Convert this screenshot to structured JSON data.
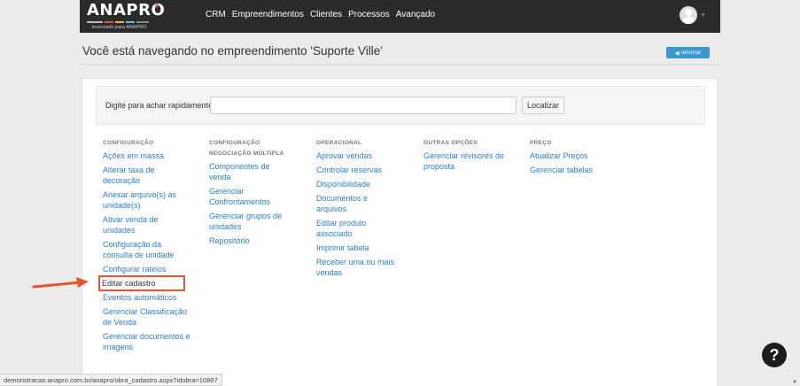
{
  "brand": {
    "name": "ANAPRO",
    "plus": "+",
    "tagline": "licenciado para ANAPRO"
  },
  "nav": {
    "items": [
      "CRM",
      "Empreendimentos",
      "Clientes",
      "Processos",
      "Avançado"
    ]
  },
  "header": {
    "title": "Você está navegando no empreendimento 'Suporte Ville'",
    "back_label": "retornar"
  },
  "search": {
    "label": "Digite para achar rapidamente:",
    "value": "",
    "button": "Localizar"
  },
  "columns": [
    {
      "title": "CONFIGURAÇÃO",
      "links": [
        "Ações em massa",
        "Alterar taxa de decoração",
        "Anexar arquivo(s) as unidade(s)",
        "Ativar venda de unidades",
        "Configuração da consulta de unidade",
        "Configurar rateios",
        "Editar cadastro",
        "Eventos automáticos",
        "Gerenciar Classificação de Venda",
        "Gerenciar documentos e imagens"
      ]
    },
    {
      "title": "CONFIGURAÇÃO NEGOCIAÇÃO MÚLTIPLA",
      "links": [
        "Componentes de venda",
        "Gerenciar Confrontamentos",
        "Gerenciar grupos de unidades",
        "Repositório"
      ]
    },
    {
      "title": "OPERACIONAL",
      "links": [
        "Aprovar vendas",
        "Controlar reservas",
        "Disponibilidade",
        "Documentos e arquivos",
        "Editar produto associado",
        "Imprimir tabela",
        "Receber uma ou mais vendas"
      ]
    },
    {
      "title": "OUTRAS OPÇÕES",
      "links": [
        "Gerenciar revisores de proposta"
      ]
    },
    {
      "title": "PREÇO",
      "links": [
        "Atualizar Preços",
        "Gerenciar tabelas"
      ]
    }
  ],
  "status_url": "demonstracao.anapro.com.br/anapro/obra_cadastro.aspx?idobra=10867",
  "help": "?",
  "colors": {
    "navbar": "#2b2b2b",
    "link": "#2a7fc4",
    "button_primary": "#3a97d4",
    "highlight": "#e4572e"
  }
}
